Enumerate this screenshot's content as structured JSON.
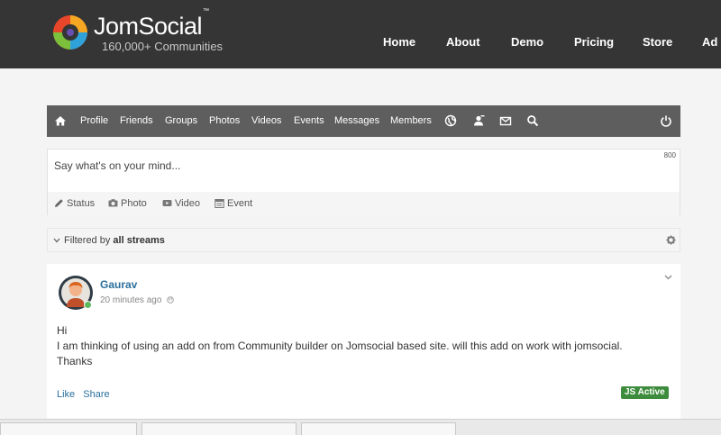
{
  "header": {
    "brand": "JomSocial",
    "trademark": "™",
    "tagline": "160,000+ Communities",
    "nav": [
      "Home",
      "About",
      "Demo",
      "Pricing",
      "Store",
      "Ad"
    ]
  },
  "toolbar": {
    "items": [
      "Profile",
      "Friends",
      "Groups",
      "Photos",
      "Videos",
      "Events",
      "Messages",
      "Members"
    ],
    "icons": [
      "home-icon",
      "globe-icon",
      "friend-request-icon",
      "mail-icon",
      "search-icon",
      "power-icon"
    ]
  },
  "status": {
    "placeholder": "Say what's on your mind...",
    "char_count": "800",
    "actions": [
      "Status",
      "Photo",
      "Video",
      "Event"
    ]
  },
  "filter": {
    "prefix": "Filtered by",
    "value": "all streams"
  },
  "post": {
    "author": "Gaurav",
    "time": "20 minutes ago",
    "lines": [
      "Hi",
      "I am thinking of using an add on from Community builder on Jomsocial based site. will this add on work with jomsocial.",
      "Thanks"
    ],
    "like": "Like",
    "share": "Share",
    "badge": "JS Active"
  },
  "colors": {
    "header_bg": "#353535",
    "toolbar_bg": "#5e5e5e",
    "link": "#2a6f9b",
    "badge": "#3d8c3d"
  }
}
